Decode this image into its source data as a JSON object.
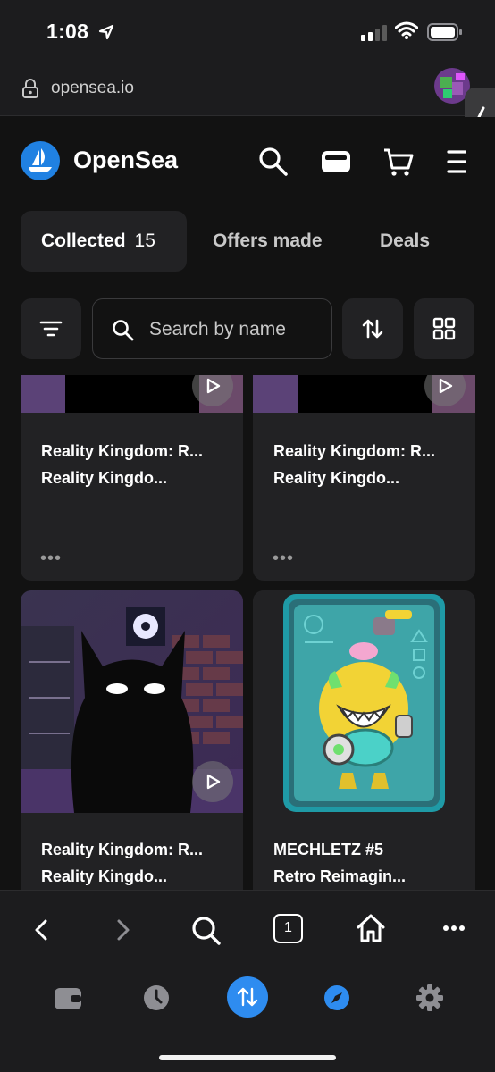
{
  "status_bar": {
    "time": "1:08"
  },
  "browser": {
    "url": "opensea.io",
    "open_tabs": "1"
  },
  "header": {
    "brand": "OpenSea"
  },
  "tabs": [
    {
      "label": "Collected",
      "count": "15"
    },
    {
      "label": "Offers made"
    },
    {
      "label": "Deals"
    }
  ],
  "search": {
    "placeholder": "Search by name"
  },
  "items": [
    {
      "title": "Reality Kingdom: R...",
      "subtitle": "Reality Kingdo...",
      "more": "•••"
    },
    {
      "title": "Reality Kingdom: R...",
      "subtitle": "Reality Kingdo...",
      "more": "•••"
    },
    {
      "title": "Reality Kingdom: R...",
      "subtitle": "Reality Kingdo..."
    },
    {
      "title": "MECHLETZ #5",
      "subtitle": "Retro Reimagin..."
    }
  ],
  "icons": {
    "header": [
      "search-icon",
      "wallet-icon",
      "cart-icon",
      "menu-icon"
    ],
    "browser_toolbar": [
      "back-icon",
      "forward-icon",
      "search-icon",
      "tabs-icon",
      "home-icon",
      "more-icon"
    ],
    "bottom_bar": [
      "wallet-icon",
      "history-icon",
      "swap-icon",
      "explore-icon",
      "settings-icon"
    ]
  },
  "colors": {
    "background": "#121212",
    "card": "#222224",
    "brand_blue": "#2081e2",
    "accent_blue": "#2e8cf0"
  }
}
